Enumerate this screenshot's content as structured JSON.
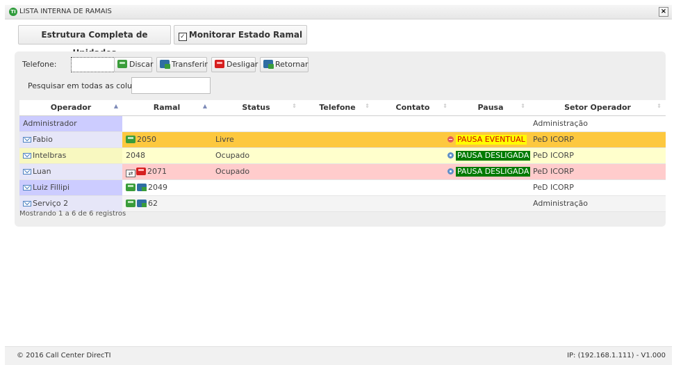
{
  "window": {
    "title": "LISTA INTERNA DE RAMAIS",
    "icon_text": "TI",
    "close_label": "×"
  },
  "top_buttons": {
    "estrutura_label": "Estrutura Completa de Unidades",
    "monitor_label": "Monitorar Estado Ramal",
    "monitor_checked": "✓"
  },
  "toolbar": {
    "telefone_label": "Telefone:",
    "telefone_value": "",
    "discar": "Discar",
    "transferir": "Transferir",
    "desligar": "Desligar",
    "retornar": "Retornar",
    "search_label": "Pesquisar em todas as colunas:",
    "search_value": ""
  },
  "table": {
    "headers": {
      "operador": "Operador",
      "ramal": "Ramal",
      "status": "Status",
      "telefone": "Telefone",
      "contato": "Contato",
      "pausa": "Pausa",
      "setor": "Setor Operador"
    },
    "rows": [
      {
        "operador": "Administrador",
        "ramal": "",
        "status": "",
        "telefone": "",
        "contato": "",
        "pausa": "",
        "setor": "Administração",
        "bg": "#ffffff",
        "op_bg": "#ccccff"
      },
      {
        "operador": "Fabio",
        "ramal": "2050",
        "status": "Livre",
        "telefone": "",
        "contato": "",
        "pausa": "PAUSA EVENTUAL",
        "setor": "PeD ICORP",
        "bg": "#fdc83f",
        "op_bg": "#e6e6f8"
      },
      {
        "operador": "Intelbras",
        "ramal": "2048",
        "status": "Ocupado",
        "telefone": "",
        "contato": "",
        "pausa": "PAUSA DESLIGADA",
        "setor": "PeD ICORP",
        "bg": "#ffffcc",
        "op_bg": "#f8f8c0"
      },
      {
        "operador": "Luan",
        "ramal": "2071",
        "status": "Ocupado",
        "telefone": "",
        "contato": "",
        "pausa": "PAUSA DESLIGADA",
        "setor": "PeD ICORP",
        "bg": "#ffcccc",
        "op_bg": "#e6e6f8"
      },
      {
        "operador": "Luiz Fillipi",
        "ramal": "2049",
        "status": "",
        "telefone": "",
        "contato": "",
        "pausa": "",
        "setor": "PeD ICORP",
        "bg": "#ffffff",
        "op_bg": "#ccccff"
      },
      {
        "operador": "Serviço 2",
        "ramal": "62",
        "status": "",
        "telefone": "",
        "contato": "",
        "pausa": "",
        "setor": "Administração",
        "bg": "#f4f4f4",
        "op_bg": "#e6e6f8"
      }
    ]
  },
  "info": "Mostrando 1 a 6 de 6 registros",
  "footer": {
    "left": "© 2016 Call Center DirecTI",
    "right": "IP: (192.168.1.111) - V1.000"
  }
}
